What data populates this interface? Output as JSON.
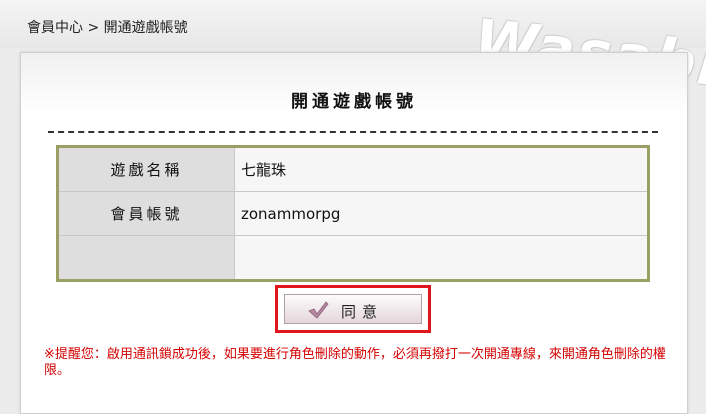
{
  "breadcrumb": {
    "root": "會員中心",
    "separator": ">",
    "current": "開通遊戲帳號"
  },
  "logo": {
    "text": "Wasabii"
  },
  "page": {
    "title": "開通遊戲帳號"
  },
  "form": {
    "rows": [
      {
        "label": "遊戲名稱",
        "value": "七龍珠"
      },
      {
        "label": "會員帳號",
        "value": "zonammorpg"
      },
      {
        "label": "",
        "value": ""
      }
    ]
  },
  "agree_button": {
    "label": "同意",
    "icon": "check-icon"
  },
  "notice": {
    "text": "※提醒您：啟用通訊鎖成功後，如果要進行角色刪除的動作，必須再撥打一次開通專線，來開通角色刪除的權限。"
  },
  "colors": {
    "table_border": "#9aa064",
    "highlight_frame": "#e0161c",
    "notice_text": "#d40000"
  }
}
